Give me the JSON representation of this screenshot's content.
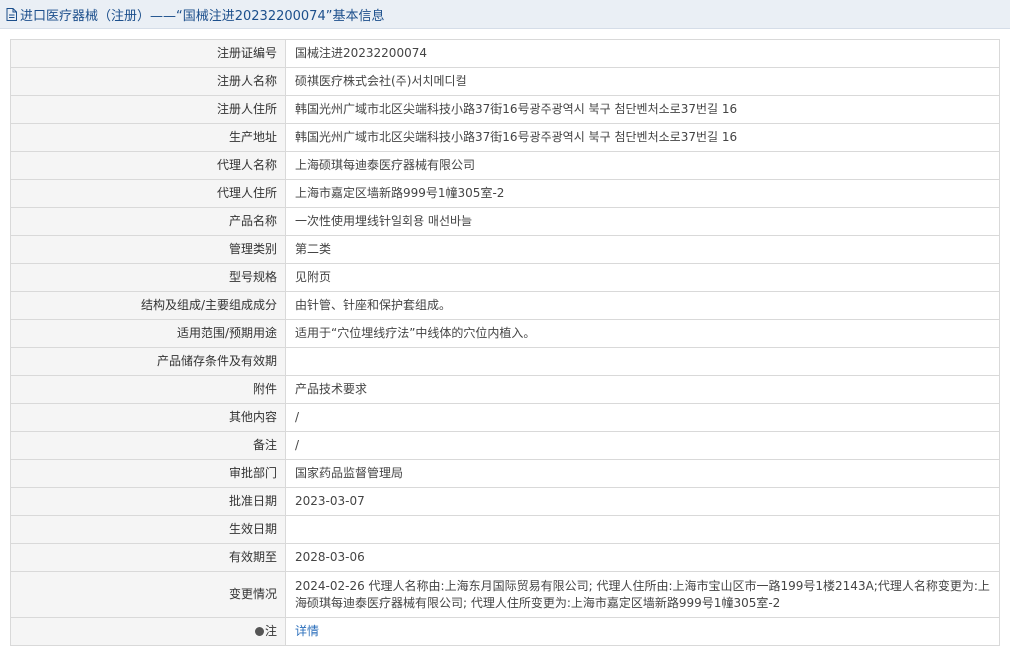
{
  "header": {
    "title": "进口医疗器械（注册）——“国械注进20232200074”基本信息",
    "icon": "document-icon"
  },
  "rows": [
    {
      "label": "注册证编号",
      "value": "国械注进20232200074"
    },
    {
      "label": "注册人名称",
      "value": "硕祺医疗株式会社(주)서치메디컬"
    },
    {
      "label": "注册人住所",
      "value": "韩国光州广域市北区尖端科技小路37街16号광주광역시 북구 첨단벤처소로37번길 16"
    },
    {
      "label": "生产地址",
      "value": "韩国光州广域市北区尖端科技小路37街16号광주광역시 북구 첨단벤처소로37번길 16"
    },
    {
      "label": "代理人名称",
      "value": "上海硕琪每迪泰医疗器械有限公司"
    },
    {
      "label": "代理人住所",
      "value": "上海市嘉定区墙新路999号1幢305室-2"
    },
    {
      "label": "产品名称",
      "value": "一次性使用埋线针일회용 매선바늘"
    },
    {
      "label": "管理类别",
      "value": "第二类"
    },
    {
      "label": "型号规格",
      "value": "见附页"
    },
    {
      "label": "结构及组成/主要组成成分",
      "value": "由针管、针座和保护套组成。"
    },
    {
      "label": "适用范围/预期用途",
      "value": "适用于“穴位埋线疗法”中线体的穴位内植入。"
    },
    {
      "label": "产品储存条件及有效期",
      "value": ""
    },
    {
      "label": "附件",
      "value": "产品技术要求"
    },
    {
      "label": "其他内容",
      "value": "/"
    },
    {
      "label": "备注",
      "value": "/"
    },
    {
      "label": "审批部门",
      "value": "国家药品监督管理局"
    },
    {
      "label": "批准日期",
      "value": "2023-03-07"
    },
    {
      "label": "生效日期",
      "value": ""
    },
    {
      "label": "有效期至",
      "value": "2028-03-06"
    },
    {
      "label": "变更情况",
      "value": "2024-02-26 代理人名称由:上海东月国际贸易有限公司; 代理人住所由:上海市宝山区市一路199号1楼2143A;代理人名称变更为:上海硕琪每迪泰医疗器械有限公司; 代理人住所变更为:上海市嘉定区墙新路999号1幢305室-2"
    }
  ],
  "note": {
    "label": "注",
    "link": "详情",
    "icon": "pin-icon"
  }
}
